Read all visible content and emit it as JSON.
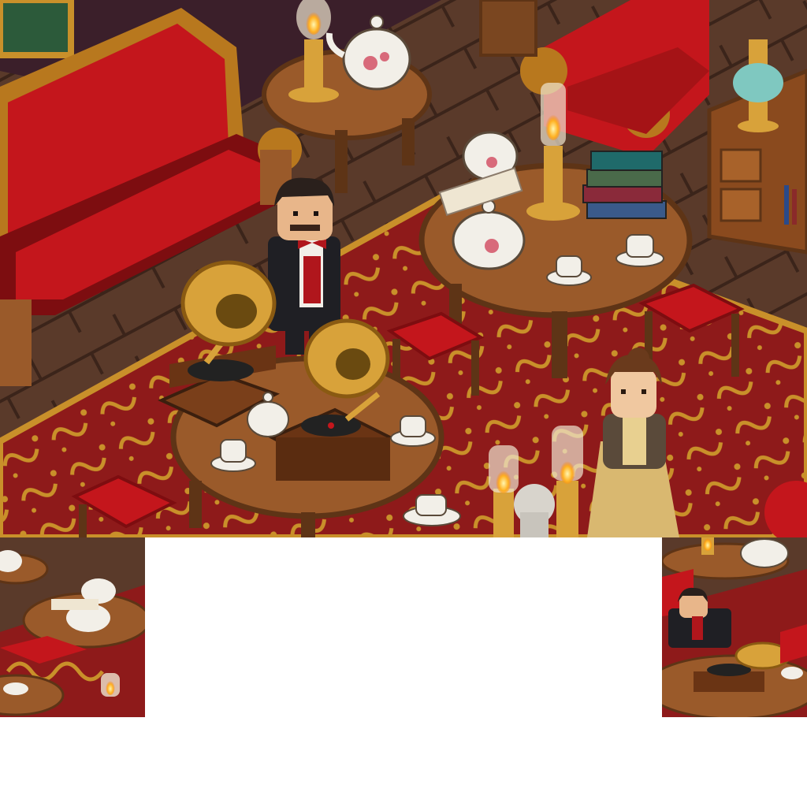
{
  "scene": {
    "name": "victorian-parlor",
    "palette": {
      "floor": "#5a3a2a",
      "floor_dark": "#3b241a",
      "rug": "#8e1a1a",
      "rug_pattern": "#c9902a",
      "velvet": "#c4161c",
      "velvet_dark": "#7d0d10",
      "wood": "#9a5a2a",
      "wood_dark": "#5e3416",
      "brass": "#d8a23a",
      "porcelain": "#f2efe8",
      "wall": "#3b1f2a"
    }
  },
  "thumbnails": {
    "left": {
      "name": "thumbnail-left"
    },
    "right": {
      "name": "thumbnail-right"
    }
  }
}
